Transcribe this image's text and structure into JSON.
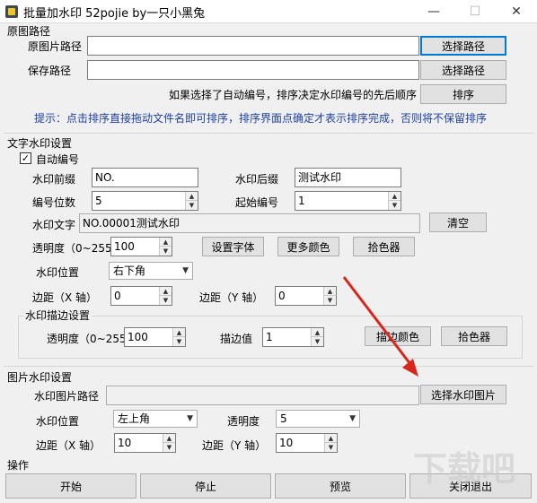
{
  "window": {
    "title": "批量加水印 52pojie by一只小黑兔",
    "minimize": "—",
    "maximize": "☐",
    "close": "✕"
  },
  "paths": {
    "group_title": "原图路径",
    "source_label": "原图片路径",
    "source_value": "",
    "source_button": "选择路径",
    "save_label": "保存路径",
    "save_value": "",
    "save_button": "选择路径",
    "sort_note": "如果选择了自动编号，排序决定水印编号的先后顺序",
    "sort_button": "排序",
    "hint": "提示：点击排序直接拖动文件名即可排序，排序界面点确定才表示排序完成，否则将不保留排序"
  },
  "text_watermark": {
    "group_title": "文字水印设置",
    "auto_number_label": "自动编号",
    "auto_number_checked": true,
    "prefix_label": "水印前缀",
    "prefix_value": "NO.",
    "suffix_label": "水印后缀",
    "suffix_value": "测试水印",
    "digits_label": "编号位数",
    "digits_value": "5",
    "start_label": "起始编号",
    "start_value": "1",
    "text_label": "水印文字",
    "text_value": "NO.00001测试水印",
    "clear_button": "清空",
    "opacity_label": "透明度（0~255）",
    "opacity_value": "100",
    "font_button": "设置字体",
    "more_colors_button": "更多颜色",
    "color_picker_button": "拾色器",
    "position_label": "水印位置",
    "position_value": "右下角",
    "margin_x_label": "边距（X 轴）",
    "margin_x_value": "0",
    "margin_y_label": "边距（Y 轴）",
    "margin_y_value": "0"
  },
  "stroke": {
    "group_title": "水印描边设置",
    "opacity_label": "透明度（0~255）",
    "opacity_value": "100",
    "stroke_label": "描边值",
    "stroke_value": "1",
    "color_button": "描边颜色",
    "picker_button": "拾色器"
  },
  "image_watermark": {
    "group_title": "图片水印设置",
    "path_label": "水印图片路径",
    "path_value": "",
    "choose_button": "选择水印图片",
    "position_label": "水印位置",
    "position_value": "左上角",
    "opacity_label": "透明度",
    "opacity_value": "5",
    "margin_x_label": "边距（X 轴）",
    "margin_x_value": "10",
    "margin_y_label": "边距（Y 轴）",
    "margin_y_value": "10"
  },
  "operations": {
    "group_title": "操作",
    "start_button": "开始",
    "stop_button": "停止",
    "preview_button": "预览",
    "close_button": "关闭退出"
  },
  "overlay": {
    "watermark_text": "下载吧",
    "arrow_color": "#d9261c"
  },
  "colors": {
    "hint_text": "#1d3fa5",
    "focus_border": "#0078d7"
  }
}
